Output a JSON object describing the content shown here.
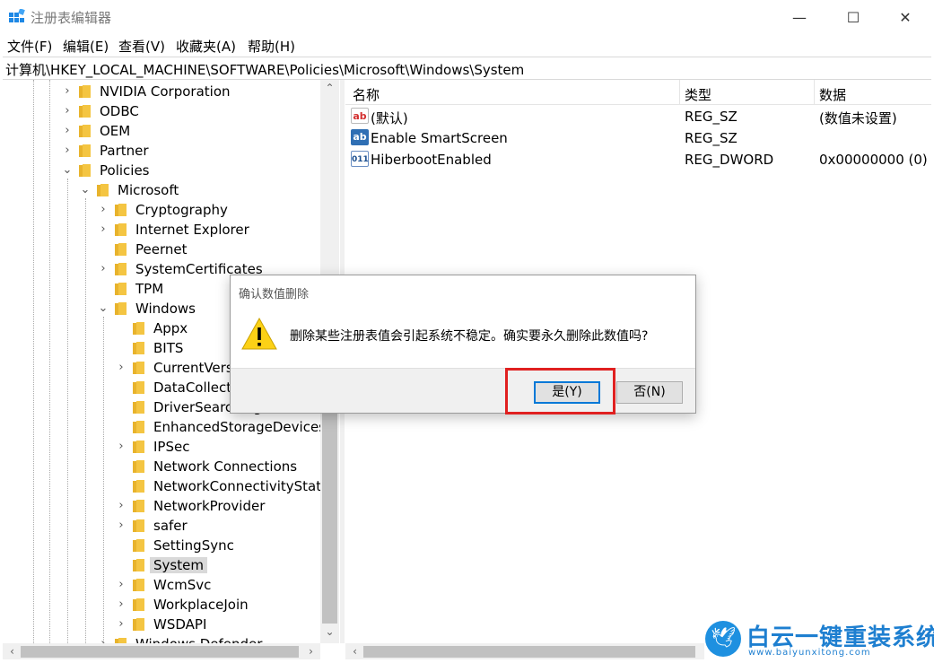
{
  "window": {
    "title": "注册表编辑器",
    "minimize_glyph": "—",
    "maximize_glyph": "☐",
    "close_glyph": "✕"
  },
  "menu": {
    "file": "文件(F)",
    "edit": "编辑(E)",
    "view": "查看(V)",
    "favorites": "收藏夹(A)",
    "help": "帮助(H)"
  },
  "address": "计算机\\HKEY_LOCAL_MACHINE\\SOFTWARE\\Policies\\Microsoft\\Windows\\System",
  "tree": {
    "items": [
      {
        "label": "NVIDIA Corporation",
        "chevron": "›"
      },
      {
        "label": "ODBC",
        "chevron": "›"
      },
      {
        "label": "OEM",
        "chevron": "›"
      },
      {
        "label": "Partner",
        "chevron": "›"
      },
      {
        "label": "Policies",
        "chevron": "⌄"
      },
      {
        "label": "Microsoft",
        "chevron": "⌄"
      },
      {
        "label": "Cryptography",
        "chevron": "›"
      },
      {
        "label": "Internet Explorer",
        "chevron": "›"
      },
      {
        "label": "Peernet",
        "chevron": ""
      },
      {
        "label": "SystemCertificates",
        "chevron": "›"
      },
      {
        "label": "TPM",
        "chevron": ""
      },
      {
        "label": "Windows",
        "chevron": "⌄"
      },
      {
        "label": "Appx",
        "chevron": ""
      },
      {
        "label": "BITS",
        "chevron": ""
      },
      {
        "label": "CurrentVersion",
        "chevron": "›"
      },
      {
        "label": "DataCollection",
        "chevron": ""
      },
      {
        "label": "DriverSearching",
        "chevron": ""
      },
      {
        "label": "EnhancedStorageDevices",
        "chevron": ""
      },
      {
        "label": "IPSec",
        "chevron": "›"
      },
      {
        "label": "Network Connections",
        "chevron": ""
      },
      {
        "label": "NetworkConnectivityStatusIndicator",
        "chevron": ""
      },
      {
        "label": "NetworkProvider",
        "chevron": "›"
      },
      {
        "label": "safer",
        "chevron": "›"
      },
      {
        "label": "SettingSync",
        "chevron": ""
      },
      {
        "label": "System",
        "chevron": ""
      },
      {
        "label": "WcmSvc",
        "chevron": "›"
      },
      {
        "label": "WorkplaceJoin",
        "chevron": "›"
      },
      {
        "label": "WSDAPI",
        "chevron": "›"
      },
      {
        "label": "Windows Defender",
        "chevron": "›"
      }
    ],
    "selected": "System"
  },
  "list": {
    "headers": {
      "name": "名称",
      "type": "类型",
      "data": "数据"
    },
    "rows": [
      {
        "icon": "ab",
        "name": "(默认)",
        "type": "REG_SZ",
        "data": "(数值未设置)"
      },
      {
        "icon": "ab",
        "name": "Enable SmartScreen",
        "type": "REG_SZ",
        "data": ""
      },
      {
        "icon": "011",
        "name": "HiberbootEnabled",
        "type": "REG_DWORD",
        "data": "0x00000000 (0)"
      }
    ]
  },
  "dialog": {
    "title": "确认数值删除",
    "message": "删除某些注册表值会引起系统不稳定。确实要永久删除此数值吗?",
    "yes": "是(Y)",
    "no": "否(N)"
  },
  "watermark": {
    "text": "白云一键重装系统",
    "url": "www.baiyunxitong.com"
  },
  "colors": {
    "accent": "#0078d7",
    "highlight": "#e02020",
    "folder": "#f4c542"
  }
}
